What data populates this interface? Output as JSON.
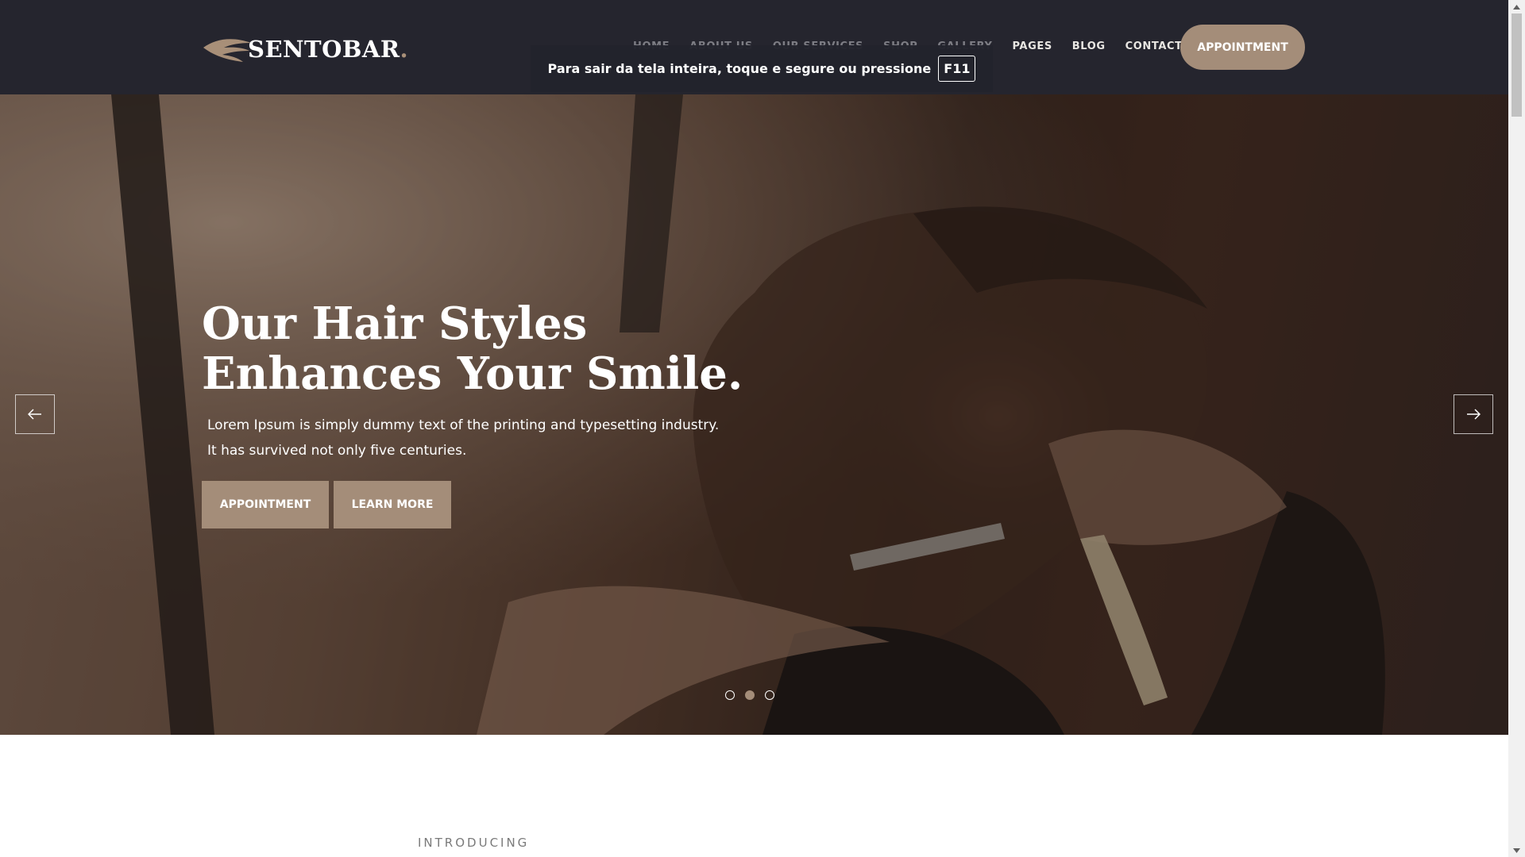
{
  "brand": {
    "name": "SENTOBAR",
    "dot": "."
  },
  "nav": {
    "items": [
      {
        "label": "HOME"
      },
      {
        "label": "ABOUT US"
      },
      {
        "label": "OUR SERVICES"
      },
      {
        "label": "SHOP"
      },
      {
        "label": "GALLERY"
      },
      {
        "label": "PAGES"
      },
      {
        "label": "BLOG"
      },
      {
        "label": "CONTACT"
      }
    ],
    "cta_label": "APPOINTMENT"
  },
  "fullscreen_notice": {
    "text": "Para sair da tela inteira, toque e segure ou pressione",
    "key": "F11"
  },
  "hero": {
    "title_line1": "Our Hair Styles",
    "title_line2": "Enhances Your Smile.",
    "subtitle_line1": "Lorem Ipsum is simply dummy text of the printing and typesetting industry.",
    "subtitle_line2": "It has survived not only five centuries.",
    "primary_button": "APPOINTMENT",
    "secondary_button": "LEARN MORE",
    "slides": {
      "count": 3,
      "active_index": 1
    }
  },
  "intro": {
    "label": "INTRODUCING"
  },
  "colors": {
    "header_bg": "#25252e",
    "accent": "#a48d79"
  }
}
